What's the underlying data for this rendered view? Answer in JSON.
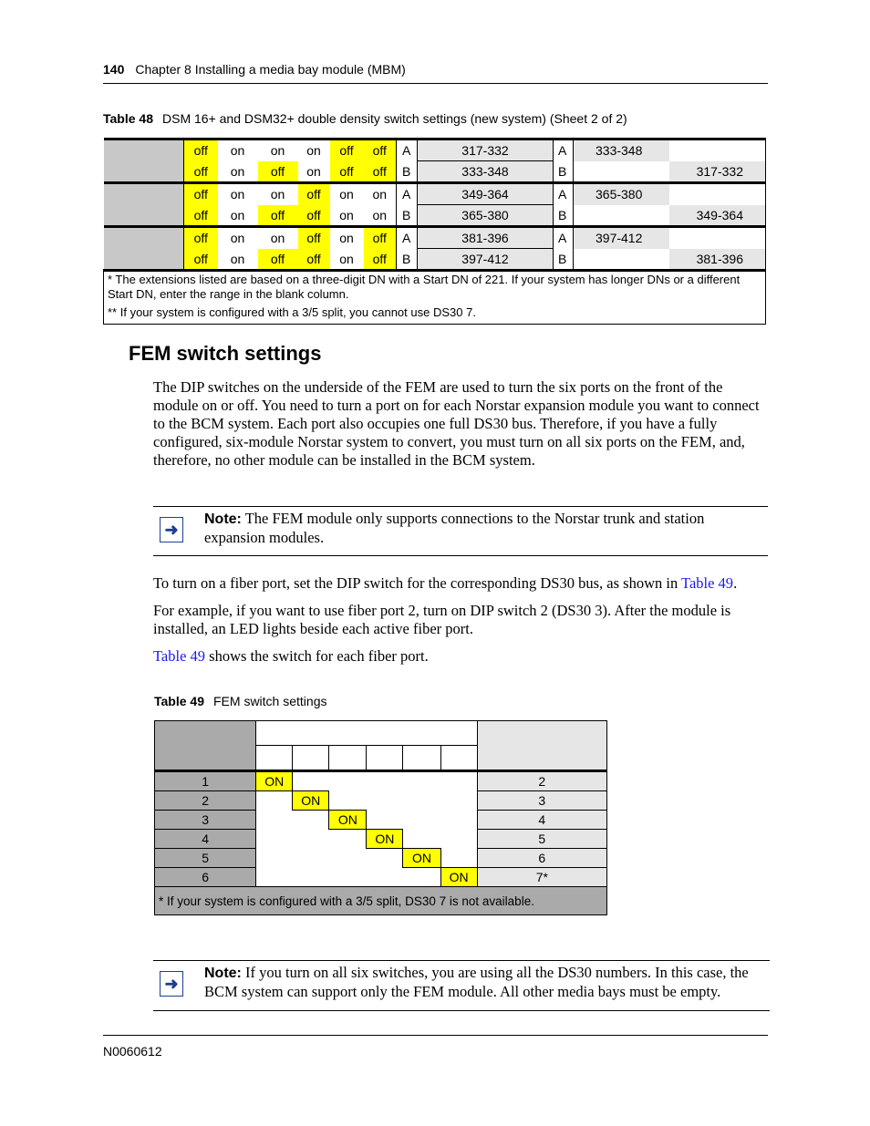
{
  "header": {
    "page_number": "140",
    "chapter": "Chapter 8  Installing a media bay module (MBM)"
  },
  "table48": {
    "number": "Table 48",
    "title": "DSM 16+ and DSM32+ double density switch settings (new system) (Sheet 2 of 2)",
    "groups": [
      {
        "rows": [
          {
            "switches": [
              "off",
              "on",
              "on",
              "on",
              "off",
              "off"
            ],
            "bank": "A",
            "range": "317-332",
            "bank2": "A",
            "colA": "333-348",
            "colB": ""
          },
          {
            "switches": [
              "off",
              "on",
              "off",
              "on",
              "off",
              "off"
            ],
            "bank": "B",
            "range": "333-348",
            "bank2": "B",
            "colA": "",
            "colB": "317-332"
          }
        ]
      },
      {
        "rows": [
          {
            "switches": [
              "off",
              "on",
              "on",
              "off",
              "on",
              "on"
            ],
            "bank": "A",
            "range": "349-364",
            "bank2": "A",
            "colA": "365-380",
            "colB": ""
          },
          {
            "switches": [
              "off",
              "on",
              "off",
              "off",
              "on",
              "on"
            ],
            "bank": "B",
            "range": "365-380",
            "bank2": "B",
            "colA": "",
            "colB": "349-364"
          }
        ]
      },
      {
        "rows": [
          {
            "switches": [
              "off",
              "on",
              "on",
              "off",
              "on",
              "off"
            ],
            "bank": "A",
            "range": "381-396",
            "bank2": "A",
            "colA": "397-412",
            "colB": ""
          },
          {
            "switches": [
              "off",
              "on",
              "off",
              "off",
              "on",
              "off"
            ],
            "bank": "B",
            "range": "397-412",
            "bank2": "B",
            "colA": "",
            "colB": "381-396"
          }
        ]
      }
    ],
    "footnotes": [
      "* The extensions listed are based on a three-digit DN with a Start DN of 221. If your system has longer DNs or a different Start DN, enter the range in the blank column.",
      "** If your system is configured with a 3/5 split, you cannot use DS30 7."
    ]
  },
  "section": {
    "title": "FEM switch settings",
    "paragraph1": "The DIP switches on the underside of the FEM are used to turn the six ports on the front of the module on or off. You need to turn a port on for each Norstar expansion module you want to connect to the BCM system. Each port also occupies one full DS30 bus. Therefore, if you have a fully configured, six-module Norstar system to convert, you must turn on all six ports on the FEM, and, therefore, no other module can be installed in the BCM system.",
    "note1": {
      "label": "Note:",
      "text": " The FEM module only supports connections to the Norstar trunk and station expansion modules."
    },
    "paragraph2_before": "To turn on a fiber port, set the DIP switch for the corresponding DS30 bus, as shown in ",
    "paragraph2_link": "Table 49",
    "paragraph2_after": ".",
    "paragraph3": "For example, if you want to use fiber port 2, turn on DIP switch 2 (DS30 3). After the module is installed, an LED lights beside each active fiber port.",
    "paragraph4_link": "Table 49",
    "paragraph4_after": " shows the switch for each fiber port.",
    "note2": {
      "label": "Note:",
      "text": " If you turn on all six switches, you are using all the DS30 numbers. In this case, the BCM system can support only the FEM module. All other media bays must be empty."
    }
  },
  "table49": {
    "number": "Table 49",
    "title": "FEM switch settings",
    "rows": [
      {
        "port": "1",
        "on_switch": 1,
        "on_label": "ON",
        "ds30": "2"
      },
      {
        "port": "2",
        "on_switch": 2,
        "on_label": "ON",
        "ds30": "3"
      },
      {
        "port": "3",
        "on_switch": 3,
        "on_label": "ON",
        "ds30": "4"
      },
      {
        "port": "4",
        "on_switch": 4,
        "on_label": "ON",
        "ds30": "5"
      },
      {
        "port": "5",
        "on_switch": 5,
        "on_label": "ON",
        "ds30": "6"
      },
      {
        "port": "6",
        "on_switch": 6,
        "on_label": "ON",
        "ds30": "7*"
      }
    ],
    "footnote": "* If your system is configured with a 3/5 split, DS30 7 is not available."
  },
  "footer": {
    "doc_id": "N0060612"
  },
  "colors": {
    "highlight": "#ffff00",
    "link": "#1a1aee",
    "note_icon": "#1c3f94"
  }
}
